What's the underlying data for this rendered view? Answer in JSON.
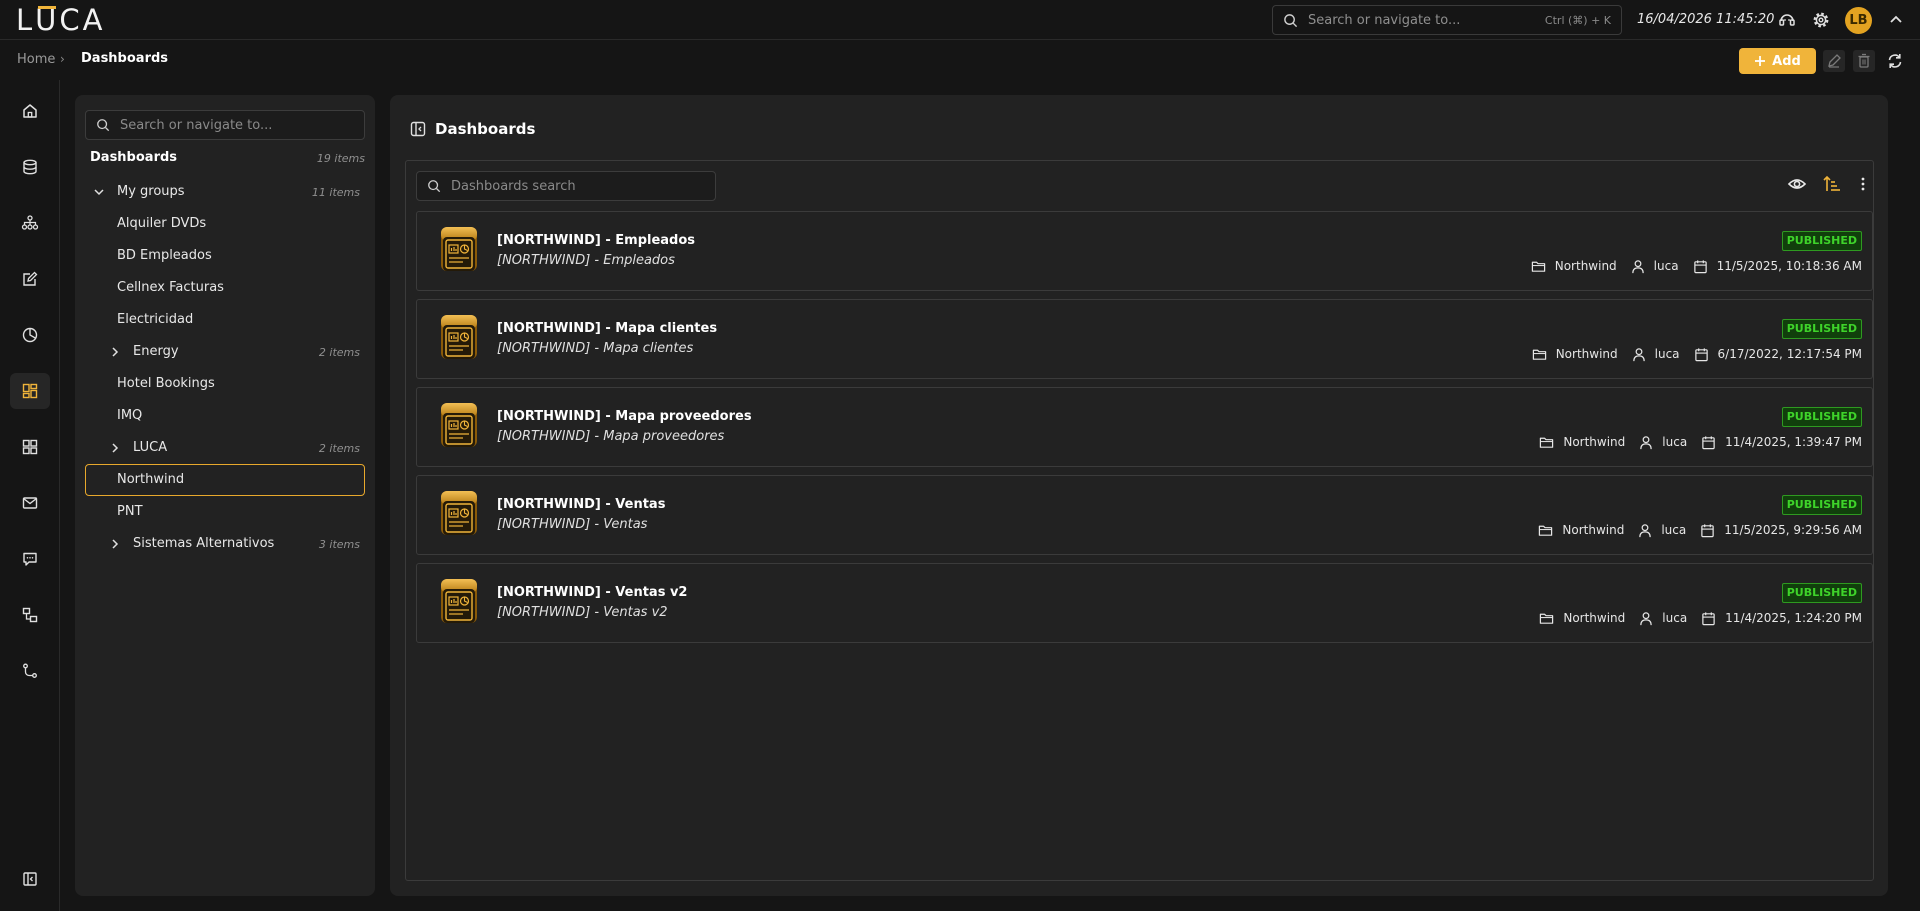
{
  "app": {
    "logo_text": "LUCA",
    "accent": "#f0b43a"
  },
  "topbar": {
    "search_placeholder": "Search or navigate to...",
    "search_shortcut": "Ctrl (⌘) + K",
    "datetime": "16/04/2026 11:45:20",
    "icons": [
      "support-icon",
      "gear-icon",
      "chevron-up-icon"
    ],
    "avatar_initials": "LB"
  },
  "breadcrumb": {
    "home": "Home",
    "current": "Dashboards"
  },
  "toolbar": {
    "add_label": "Add"
  },
  "rail": {
    "items": [
      "home-icon",
      "database-icon",
      "model-icon",
      "edit-icon",
      "chart-icon",
      "dashboards-icon",
      "widgets-icon",
      "mail-icon",
      "comments-icon",
      "flow-icon",
      "git-icon"
    ],
    "active": "dashboards-icon",
    "bottom": "collapse-sidebar-icon"
  },
  "tree": {
    "search_placeholder": "Search or navigate to...",
    "title": "Dashboards",
    "title_count": "19 items",
    "group": {
      "label": "My groups",
      "count": "11 items"
    },
    "items": [
      {
        "label": "Alquiler DVDs"
      },
      {
        "label": "BD Empleados"
      },
      {
        "label": "Cellnex Facturas"
      },
      {
        "label": "Electricidad"
      },
      {
        "label": "Energy",
        "count": "2 items",
        "expandable": true
      },
      {
        "label": "Hotel Bookings"
      },
      {
        "label": "IMQ"
      },
      {
        "label": "LUCA",
        "count": "2 items",
        "expandable": true
      },
      {
        "label": "Northwind",
        "selected": true
      },
      {
        "label": "PNT"
      },
      {
        "label": "Sistemas Alternativos",
        "count": "3 items",
        "expandable": true
      }
    ]
  },
  "main": {
    "title": "Dashboards",
    "search_placeholder": "Dashboards search",
    "cards": [
      {
        "title": "[NORTHWIND] - Empleados",
        "subtitle": "[NORTHWIND] - Empleados",
        "status": "PUBLISHED",
        "folder": "Northwind",
        "user": "luca",
        "date": "11/5/2025, 10:18:36 AM"
      },
      {
        "title": "[NORTHWIND] - Mapa clientes",
        "subtitle": "[NORTHWIND] - Mapa clientes",
        "status": "PUBLISHED",
        "folder": "Northwind",
        "user": "luca",
        "date": "6/17/2022, 12:17:54 PM"
      },
      {
        "title": "[NORTHWIND] - Mapa proveedores",
        "subtitle": "[NORTHWIND] - Mapa proveedores",
        "status": "PUBLISHED",
        "folder": "Northwind",
        "user": "luca",
        "date": "11/4/2025, 1:39:47 PM"
      },
      {
        "title": "[NORTHWIND] - Ventas",
        "subtitle": "[NORTHWIND] - Ventas",
        "status": "PUBLISHED",
        "folder": "Northwind",
        "user": "luca",
        "date": "11/5/2025, 9:29:56 AM"
      },
      {
        "title": "[NORTHWIND] - Ventas v2",
        "subtitle": "[NORTHWIND] - Ventas v2",
        "status": "PUBLISHED",
        "folder": "Northwind",
        "user": "luca",
        "date": "11/4/2025, 1:24:20 PM"
      }
    ]
  }
}
